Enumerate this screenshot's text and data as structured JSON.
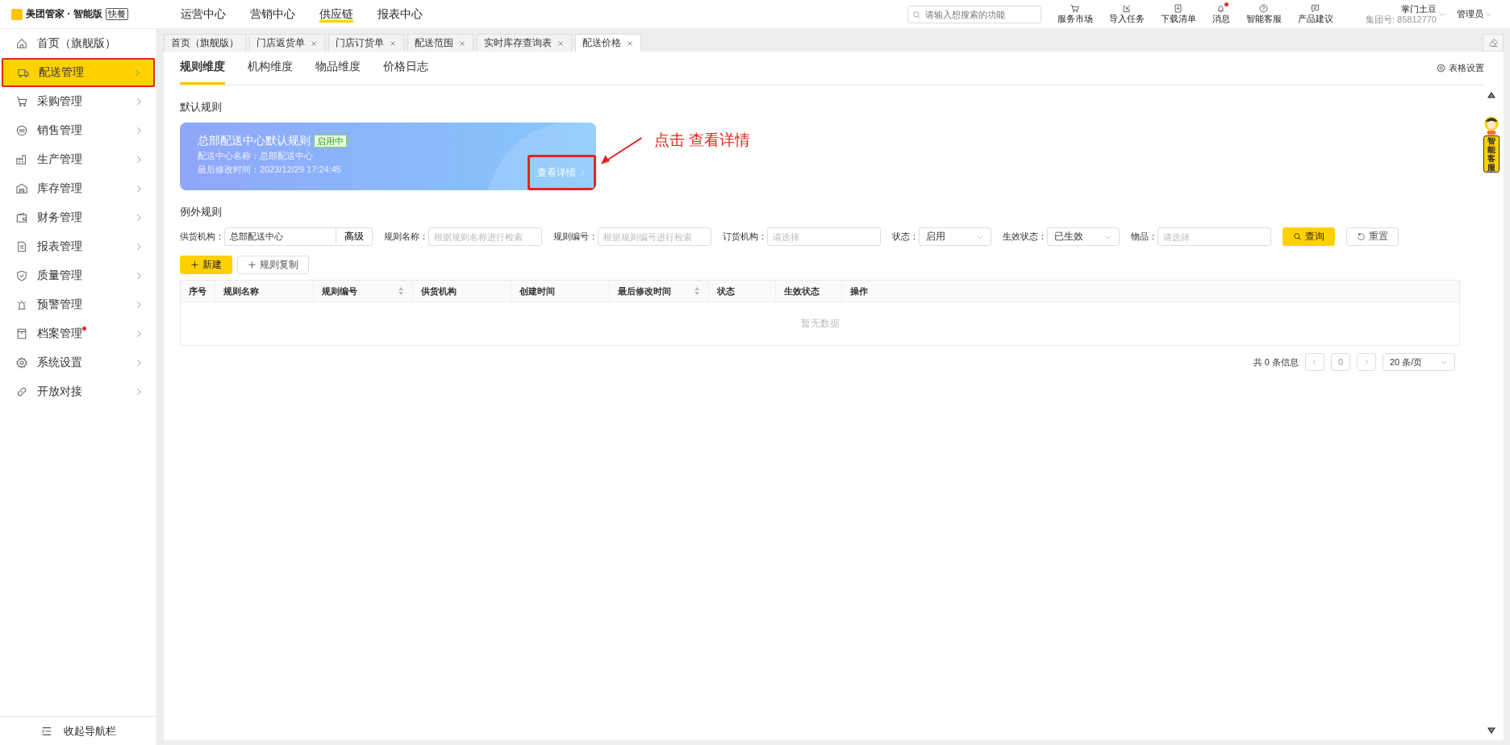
{
  "app": {
    "logo_text": "美团管家 · 智能版",
    "logo_badge": "快餐"
  },
  "top_nav": [
    {
      "label": "运营中心",
      "selected": false
    },
    {
      "label": "营销中心",
      "selected": false
    },
    {
      "label": "供应链",
      "selected": true
    },
    {
      "label": "报表中心",
      "selected": false
    }
  ],
  "search": {
    "placeholder": "请输入想搜索的功能"
  },
  "top_actions": [
    {
      "label": "服务市场",
      "badge": false
    },
    {
      "label": "导入任务",
      "badge": false
    },
    {
      "label": "下载清单",
      "badge": false
    },
    {
      "label": "消息",
      "badge": true
    },
    {
      "label": "智能客服",
      "badge": false
    },
    {
      "label": "产品建议",
      "badge": false
    }
  ],
  "account": {
    "name": "掌门土豆",
    "group": "集团号: 85812770",
    "role": "管理员"
  },
  "sidebar": {
    "items": [
      {
        "label": "首页（旗舰版）",
        "selected": false,
        "arrow": false,
        "dot": false,
        "highlighted": false
      },
      {
        "label": "配送管理",
        "selected": true,
        "arrow": true,
        "dot": false,
        "highlighted": true
      },
      {
        "label": "采购管理",
        "selected": false,
        "arrow": true,
        "dot": false,
        "highlighted": false
      },
      {
        "label": "销售管理",
        "selected": false,
        "arrow": true,
        "dot": false,
        "highlighted": false
      },
      {
        "label": "生产管理",
        "selected": false,
        "arrow": true,
        "dot": false,
        "highlighted": false
      },
      {
        "label": "库存管理",
        "selected": false,
        "arrow": true,
        "dot": false,
        "highlighted": false
      },
      {
        "label": "财务管理",
        "selected": false,
        "arrow": true,
        "dot": false,
        "highlighted": false
      },
      {
        "label": "报表管理",
        "selected": false,
        "arrow": true,
        "dot": false,
        "highlighted": false
      },
      {
        "label": "质量管理",
        "selected": false,
        "arrow": true,
        "dot": false,
        "highlighted": false
      },
      {
        "label": "预警管理",
        "selected": false,
        "arrow": true,
        "dot": false,
        "highlighted": false
      },
      {
        "label": "档案管理",
        "selected": false,
        "arrow": true,
        "dot": true,
        "highlighted": false
      },
      {
        "label": "系统设置",
        "selected": false,
        "arrow": true,
        "dot": false,
        "highlighted": false
      },
      {
        "label": "开放对接",
        "selected": false,
        "arrow": true,
        "dot": false,
        "highlighted": false
      }
    ],
    "collapse": "收起导航栏"
  },
  "page_tabs": [
    {
      "label": "首页（旗舰版）",
      "closable": false,
      "selected": false
    },
    {
      "label": "门店返货单",
      "closable": true,
      "selected": false
    },
    {
      "label": "门店订货单",
      "closable": true,
      "selected": false
    },
    {
      "label": "配送范围",
      "closable": true,
      "selected": false
    },
    {
      "label": "实时库存查询表",
      "closable": true,
      "selected": false
    },
    {
      "label": "配送价格",
      "closable": true,
      "selected": true
    }
  ],
  "sub_tabs": [
    {
      "label": "规则维度",
      "selected": true
    },
    {
      "label": "机构维度",
      "selected": false
    },
    {
      "label": "物品维度",
      "selected": false
    },
    {
      "label": "价格日志",
      "selected": false
    }
  ],
  "table_settings": "表格设置",
  "default_rules": {
    "heading": "默认规则",
    "card": {
      "title": "总部配送中心默认规则",
      "status": "启用中",
      "center": "配送中心名称：总部配送中心",
      "modified": "最后修改时间：2023/12/29 17:24:45",
      "details": "查看详情",
      "details_highlighted": true
    }
  },
  "exception_rules": {
    "heading": "例外规则",
    "filters": [
      {
        "kind": "text",
        "label": "供货机构：",
        "value": "总部配送中心",
        "addon": "高级"
      },
      {
        "kind": "text",
        "label": "规则名称：",
        "placeholder": "根据规则名称进行检索"
      },
      {
        "kind": "text",
        "label": "规则编号：",
        "placeholder": "根据规则编号进行检索"
      },
      {
        "kind": "text",
        "label": "订货机构：",
        "placeholder": "请选择"
      },
      {
        "kind": "select",
        "label": "状态：",
        "value": "启用"
      },
      {
        "kind": "select",
        "label": "生效状态：",
        "value": "已生效"
      },
      {
        "kind": "text",
        "label": "物品：",
        "placeholder": "请选择"
      }
    ],
    "query": "查询",
    "reset": "重置",
    "new": "新建",
    "copy": "规则复制"
  },
  "table": {
    "columns": [
      {
        "label": "序号",
        "sortable": false
      },
      {
        "label": "规则名称",
        "sortable": false
      },
      {
        "label": "规则编号",
        "sortable": true
      },
      {
        "label": "供货机构",
        "sortable": false
      },
      {
        "label": "创建时间",
        "sortable": false
      },
      {
        "label": "最后修改时间",
        "sortable": true
      },
      {
        "label": "状态",
        "sortable": false
      },
      {
        "label": "生效状态",
        "sortable": false
      },
      {
        "label": "操作",
        "sortable": false
      }
    ],
    "empty": "暂无数据"
  },
  "pagination": {
    "total": "共 0 条信息",
    "page": "0",
    "page_size": "20 条/页"
  },
  "helper": {
    "label": "智能客服"
  },
  "annotation": {
    "text": "点击 查看详情"
  }
}
